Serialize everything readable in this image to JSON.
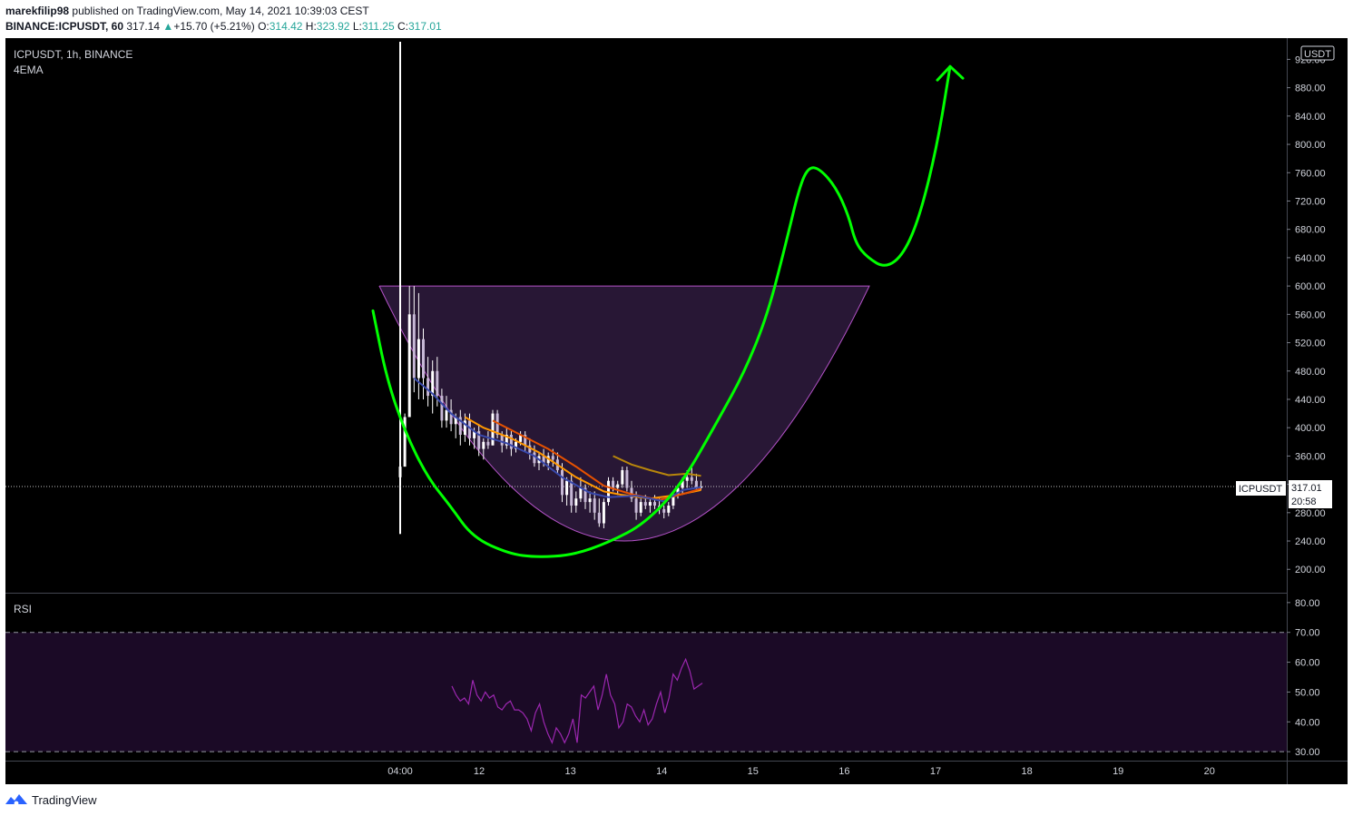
{
  "header": {
    "author": "marekfilip98",
    "published_text": "published on TradingView.com, May 14, 2021 10:39:03 CEST",
    "symbol_line": "BINANCE:ICPUSDT, 60",
    "price": "317.14",
    "change": "+15.70 (+5.21%)",
    "open_label": "O:",
    "open": "314.42",
    "high_label": "H:",
    "high": "323.92",
    "low_label": "L:",
    "low": "311.25",
    "close_label": "C:",
    "close": "317.01"
  },
  "pane": {
    "title": "ICPUSDT, 1h, BINANCE",
    "indicator": "4EMA",
    "currency": "USDT",
    "rsi_label": "RSI"
  },
  "price_tag": {
    "symbol": "ICPUSDT",
    "price": "317.01",
    "countdown": "20:58"
  },
  "footer": {
    "brand": "TradingView"
  },
  "colors": {
    "background": "#000000",
    "projection_line": "#00ff00",
    "cup_fill": "#2a1838",
    "rsi_line": "#9c27b0",
    "rsi_band": "#1b0a26",
    "candle": "#ffffff"
  },
  "chart_data": {
    "type": "candlestick",
    "price_axis": {
      "ticks": [
        200,
        240,
        280,
        320,
        360,
        400,
        440,
        480,
        520,
        560,
        600,
        640,
        680,
        720,
        760,
        800,
        840,
        880,
        920
      ],
      "range": [
        167,
        950
      ],
      "unit": "USDT",
      "grid": false
    },
    "time_axis": {
      "ticks": [
        "04:00",
        "12",
        "13",
        "14",
        "15",
        "16",
        "17",
        "18",
        "19",
        "20"
      ]
    },
    "rsi_axis": {
      "ticks": [
        30,
        40,
        50,
        60,
        70,
        80
      ],
      "range": [
        27,
        83
      ],
      "band": [
        30,
        70
      ]
    },
    "last_price": 317.01,
    "candles": [
      [
        0,
        330,
        345,
        250,
        345
      ],
      [
        1,
        345,
        420,
        345,
        415
      ],
      [
        2,
        415,
        600,
        420,
        560
      ],
      [
        3,
        560,
        600,
        450,
        470
      ],
      [
        4,
        470,
        590,
        440,
        525
      ],
      [
        5,
        525,
        540,
        440,
        470
      ],
      [
        6,
        470,
        500,
        430,
        445
      ],
      [
        7,
        445,
        495,
        420,
        480
      ],
      [
        8,
        480,
        500,
        430,
        445
      ],
      [
        9,
        445,
        455,
        400,
        410
      ],
      [
        10,
        410,
        445,
        400,
        425
      ],
      [
        11,
        425,
        440,
        395,
        405
      ],
      [
        12,
        405,
        420,
        385,
        415
      ],
      [
        13,
        415,
        425,
        375,
        390
      ],
      [
        14,
        390,
        420,
        380,
        410
      ],
      [
        15,
        410,
        420,
        375,
        385
      ],
      [
        16,
        385,
        400,
        370,
        395
      ],
      [
        17,
        395,
        405,
        360,
        370
      ],
      [
        18,
        370,
        385,
        355,
        380
      ],
      [
        19,
        380,
        395,
        370,
        375
      ],
      [
        20,
        375,
        425,
        375,
        420
      ],
      [
        21,
        420,
        425,
        385,
        390
      ],
      [
        22,
        390,
        395,
        365,
        375
      ],
      [
        23,
        375,
        400,
        370,
        390
      ],
      [
        24,
        390,
        395,
        360,
        370
      ],
      [
        25,
        370,
        385,
        365,
        380
      ],
      [
        26,
        380,
        395,
        375,
        390
      ],
      [
        27,
        390,
        395,
        365,
        375
      ],
      [
        28,
        375,
        385,
        355,
        365
      ],
      [
        29,
        365,
        375,
        345,
        350
      ],
      [
        30,
        350,
        365,
        340,
        360
      ],
      [
        31,
        360,
        370,
        345,
        350
      ],
      [
        32,
        350,
        365,
        340,
        360
      ],
      [
        33,
        360,
        370,
        345,
        355
      ],
      [
        34,
        355,
        365,
        335,
        340
      ],
      [
        35,
        340,
        350,
        295,
        305
      ],
      [
        36,
        305,
        330,
        290,
        325
      ],
      [
        37,
        325,
        335,
        280,
        290
      ],
      [
        38,
        290,
        310,
        280,
        300
      ],
      [
        39,
        300,
        330,
        295,
        315
      ],
      [
        40,
        315,
        320,
        285,
        295
      ],
      [
        41,
        295,
        310,
        280,
        300
      ],
      [
        42,
        300,
        310,
        270,
        280
      ],
      [
        43,
        280,
        300,
        260,
        265
      ],
      [
        44,
        265,
        300,
        258,
        295
      ],
      [
        45,
        295,
        330,
        290,
        325
      ],
      [
        46,
        325,
        330,
        310,
        315
      ],
      [
        47,
        315,
        325,
        305,
        320
      ],
      [
        48,
        320,
        345,
        315,
        340
      ],
      [
        49,
        340,
        345,
        310,
        315
      ],
      [
        50,
        315,
        325,
        295,
        300
      ],
      [
        51,
        300,
        310,
        270,
        280
      ],
      [
        52,
        280,
        300,
        275,
        295
      ],
      [
        53,
        295,
        305,
        285,
        290
      ],
      [
        54,
        290,
        300,
        280,
        295
      ],
      [
        55,
        295,
        305,
        285,
        290
      ],
      [
        56,
        290,
        300,
        278,
        285
      ],
      [
        57,
        285,
        290,
        272,
        280
      ],
      [
        58,
        280,
        295,
        275,
        290
      ],
      [
        59,
        290,
        310,
        285,
        305
      ],
      [
        60,
        305,
        320,
        300,
        315
      ],
      [
        61,
        315,
        330,
        305,
        325
      ],
      [
        62,
        325,
        340,
        315,
        330
      ],
      [
        63,
        330,
        345,
        320,
        325
      ],
      [
        64,
        325,
        335,
        310,
        315
      ],
      [
        65,
        315,
        325,
        312,
        317
      ]
    ],
    "ema_series": [
      {
        "color": "#ff9800",
        "values": [
          [
            14,
            415
          ],
          [
            18,
            400
          ],
          [
            24,
            385
          ],
          [
            30,
            365
          ],
          [
            38,
            330
          ],
          [
            44,
            310
          ],
          [
            48,
            305
          ],
          [
            54,
            300
          ],
          [
            60,
            305
          ],
          [
            65,
            312
          ]
        ]
      },
      {
        "color": "#e65100",
        "values": [
          [
            20,
            410
          ],
          [
            26,
            390
          ],
          [
            32,
            370
          ],
          [
            38,
            345
          ],
          [
            44,
            318
          ],
          [
            50,
            306
          ],
          [
            56,
            298
          ],
          [
            62,
            308
          ],
          [
            65,
            314
          ]
        ]
      },
      {
        "color": "#b8860b",
        "values": [
          [
            46,
            360
          ],
          [
            50,
            348
          ],
          [
            54,
            340
          ],
          [
            58,
            333
          ],
          [
            62,
            335
          ],
          [
            65,
            332
          ]
        ]
      },
      {
        "color": "#3949ab",
        "values": [
          [
            3,
            470
          ],
          [
            7,
            448
          ],
          [
            11,
            420
          ],
          [
            17,
            390
          ],
          [
            23,
            378
          ],
          [
            29,
            360
          ],
          [
            35,
            330
          ],
          [
            41,
            308
          ],
          [
            45,
            302
          ],
          [
            51,
            304
          ],
          [
            57,
            296
          ],
          [
            61,
            312
          ],
          [
            65,
            316
          ]
        ]
      }
    ],
    "rsi_values": [
      52,
      49,
      47,
      48,
      46,
      54,
      49,
      47,
      50,
      48,
      49,
      45,
      44,
      46,
      47,
      44,
      44,
      43,
      41,
      37,
      43,
      46,
      40,
      36,
      33,
      38,
      36,
      33,
      36,
      41,
      33,
      49,
      48,
      50,
      52,
      44,
      49,
      56,
      49,
      46,
      38,
      40,
      46,
      45,
      42,
      40,
      44,
      39,
      41,
      46,
      50,
      43,
      48,
      56,
      54,
      58,
      61,
      57,
      51,
      52,
      53
    ],
    "cup_pattern": {
      "top_price": 600,
      "bottom_price": 240,
      "start_time": "≈04:00",
      "end_time": "≈16 (late)"
    },
    "projection": [
      [
        -40,
        565
      ],
      [
        -25,
        470
      ],
      [
        -5,
        395
      ],
      [
        20,
        330
      ],
      [
        45,
        290
      ],
      [
        70,
        245
      ],
      [
        110,
        222
      ],
      [
        140,
        217
      ],
      [
        180,
        220
      ],
      [
        220,
        238
      ],
      [
        260,
        265
      ],
      [
        300,
        320
      ],
      [
        340,
        410
      ],
      [
        370,
        480
      ],
      [
        395,
        560
      ],
      [
        415,
        660
      ],
      [
        430,
        740
      ],
      [
        440,
        768
      ],
      [
        452,
        766
      ],
      [
        470,
        740
      ],
      [
        484,
        700
      ],
      [
        492,
        660
      ],
      [
        505,
        640
      ],
      [
        525,
        625
      ],
      [
        545,
        645
      ],
      [
        563,
        700
      ],
      [
        582,
        800
      ],
      [
        596,
        910
      ]
    ]
  }
}
